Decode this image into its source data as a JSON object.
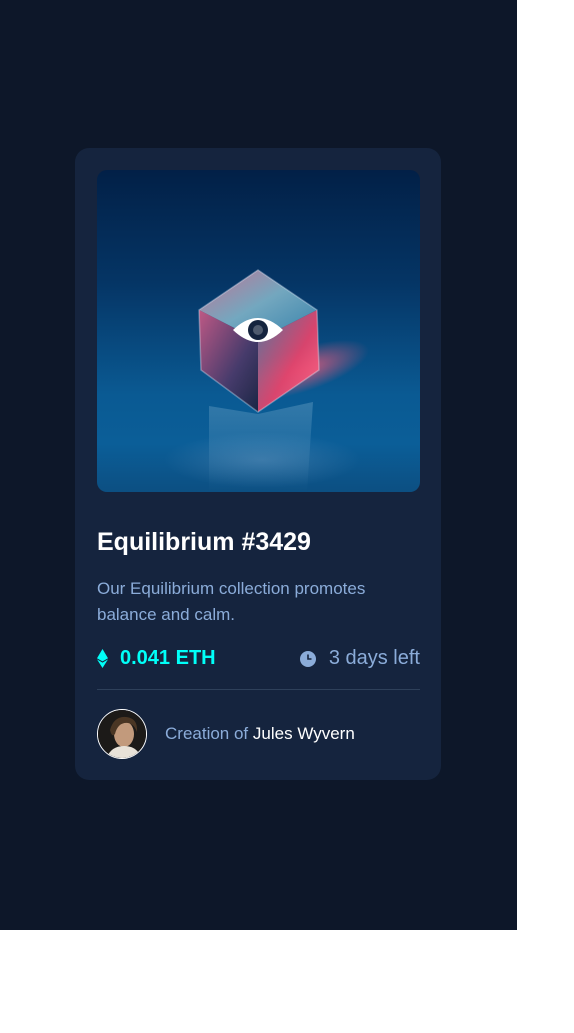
{
  "card": {
    "title": "Equilibrium #3429",
    "description": "Our Equilibrium collection promotes balance and calm.",
    "price": "0.041 ETH",
    "time_left": "3 days left",
    "creator_prefix": "Creation of",
    "creator_name": "Jules Wyvern"
  },
  "icons": {
    "price": "ethereum-icon",
    "time": "clock-icon",
    "overlay": "view-eye-icon"
  },
  "colors": {
    "background": "#0d1729",
    "card": "#15243e",
    "accent_cyan": "#00fff8",
    "soft_blue": "#8bacd9",
    "white": "#ffffff",
    "divider": "#2e405a"
  }
}
